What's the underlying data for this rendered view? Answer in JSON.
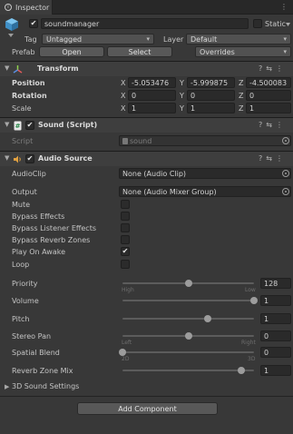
{
  "window": {
    "tab_label": "Inspector"
  },
  "object": {
    "name": "soundmanager",
    "static_label": "Static",
    "tag_label": "Tag",
    "tag_value": "Untagged",
    "layer_label": "Layer",
    "layer_value": "Default",
    "prefab_label": "Prefab",
    "open_label": "Open",
    "select_label": "Select",
    "overrides_label": "Overrides"
  },
  "transform": {
    "title": "Transform",
    "position_label": "Position",
    "rotation_label": "Rotation",
    "scale_label": "Scale",
    "position": {
      "x": "-5.053476",
      "y": "-5.999875",
      "z": "-4.500083"
    },
    "rotation": {
      "x": "0",
      "y": "0",
      "z": "0"
    },
    "scale": {
      "x": "1",
      "y": "1",
      "z": "1"
    },
    "axis": {
      "x": "X",
      "y": "Y",
      "z": "Z"
    }
  },
  "sound_script": {
    "title": "Sound (Script)",
    "script_label": "Script",
    "script_value": "sound"
  },
  "audio_source": {
    "title": "Audio Source",
    "audioclip_label": "AudioClip",
    "audioclip_value": "None (Audio Clip)",
    "output_label": "Output",
    "output_value": "None (Audio Mixer Group)",
    "mute_label": "Mute",
    "bypass_effects_label": "Bypass Effects",
    "bypass_listener_label": "Bypass Listener Effects",
    "bypass_reverb_label": "Bypass Reverb Zones",
    "play_on_awake_label": "Play On Awake",
    "loop_label": "Loop",
    "priority_label": "Priority",
    "priority_value": "128",
    "priority_high": "High",
    "priority_low": "Low",
    "volume_label": "Volume",
    "volume_value": "1",
    "pitch_label": "Pitch",
    "pitch_value": "1",
    "stereo_pan_label": "Stereo Pan",
    "stereo_pan_value": "0",
    "stereo_left": "Left",
    "stereo_right": "Right",
    "spatial_blend_label": "Spatial Blend",
    "spatial_blend_value": "0",
    "spatial_2d": "2D",
    "spatial_3d": "3D",
    "reverb_mix_label": "Reverb Zone Mix",
    "reverb_mix_value": "1",
    "sound3d_label": "3D Sound Settings",
    "checks": {
      "mute": false,
      "bypass_effects": false,
      "bypass_listener": false,
      "bypass_reverb": false,
      "play_on_awake": true,
      "loop": false
    },
    "slider_levels": {
      "priority": 0.5,
      "volume": 1.0,
      "pitch": 0.65,
      "stereo_pan": 0.5,
      "spatial_blend": 0.0,
      "reverb_mix": 0.9
    }
  },
  "footer": {
    "add_component_label": "Add Component"
  },
  "icons": {
    "tab": "info-icon",
    "cube": "cube-icon",
    "transform": "transform-axes-icon",
    "script": "script-icon",
    "audio": "audio-speaker-icon"
  },
  "colors": {
    "background": "#383838",
    "field": "#2a2a2a",
    "header": "#3e3e3e",
    "cube": "#4ea8de"
  }
}
